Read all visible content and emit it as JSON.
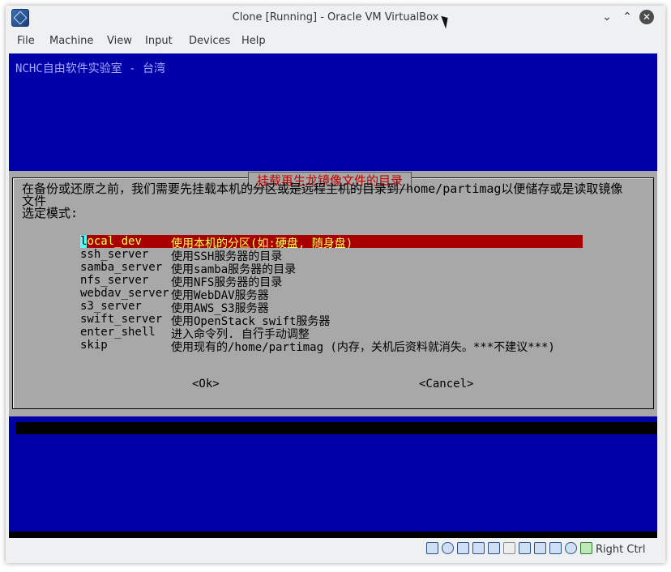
{
  "window": {
    "title": "Clone [Running] - Oracle VM VirtualBox",
    "min_icon": "chevron-down-icon",
    "max_icon": "chevron-up-icon",
    "close_icon": "close-icon"
  },
  "menubar": {
    "items": [
      "File",
      "Machine",
      "View",
      "Input",
      "Devices",
      "Help"
    ]
  },
  "screen": {
    "banner": "NCHC自由软件实验室 - 台湾",
    "dialog": {
      "title": "挂载再生龙镜像文件的目录",
      "prompt_line1": "在备份或还原之前，我们需要先挂载本机的分区或是远程主机的目录到/home/partimag以便储存或是读取镜像",
      "prompt_line2": "文件",
      "prompt_line3": "选定模式:",
      "options": [
        {
          "key": "local_dev",
          "desc": "使用本机的分区(如:硬盘, 随身盘)"
        },
        {
          "key": "ssh_server",
          "desc": "使用SSH服务器的目录"
        },
        {
          "key": "samba_server",
          "desc": "使用samba服务器的目录"
        },
        {
          "key": "nfs_server",
          "desc": "使用NFS服务器的目录"
        },
        {
          "key": "webdav_server",
          "desc": "使用WebDAV服务器"
        },
        {
          "key": "s3_server",
          "desc": "使用AWS_S3服务器"
        },
        {
          "key": "swift_server",
          "desc": "使用OpenStack_swift服务器"
        },
        {
          "key": "enter_shell",
          "desc": "进入命令列. 自行手动调整"
        },
        {
          "key": "skip",
          "desc": "使用现有的/home/partimag (内存，关机后资料就消失。***不建议***)"
        }
      ],
      "ok_label": "<Ok>",
      "cancel_label": "<Cancel>"
    }
  },
  "statusbar": {
    "host_key": "Right Ctrl",
    "icons": [
      "hard-disk-icon",
      "optical-drive-icon",
      "audio-icon",
      "network-icon",
      "usb-icon",
      "shared-folder-icon",
      "display-icon",
      "video-capture-icon",
      "cpu-icon",
      "mouse-integration-icon",
      "keyboard-icon"
    ]
  }
}
